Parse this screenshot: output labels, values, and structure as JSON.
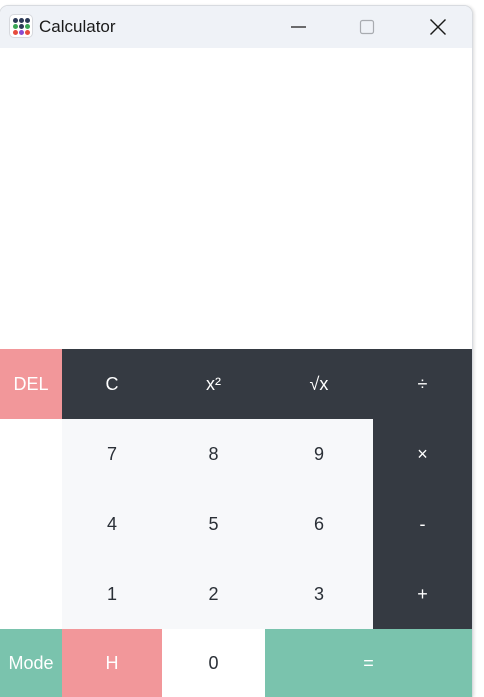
{
  "window": {
    "title": "Calculator",
    "icon": "calculator-app-icon",
    "controls": {
      "minimize_icon": "minimize-icon",
      "maximize_icon": "maximize-icon",
      "close_icon": "close-icon"
    }
  },
  "display": {
    "expression": "",
    "result": ""
  },
  "keys": {
    "del": "DEL",
    "clear": "C",
    "square": "x²",
    "sqrt": "√x",
    "divide": "÷",
    "seven": "7",
    "eight": "8",
    "nine": "9",
    "multiply": "×",
    "four": "4",
    "five": "5",
    "six": "6",
    "minus": "-",
    "one": "1",
    "two": "2",
    "three": "3",
    "plus": "+",
    "mode": "Mode",
    "history": "H",
    "zero": "0",
    "equals": "="
  },
  "colors": {
    "dark_key": "#353a42",
    "light_key": "#f7f8fa",
    "red_key": "#f2979a",
    "green_key": "#7ac3ad",
    "titlebar": "#eff2f7"
  }
}
